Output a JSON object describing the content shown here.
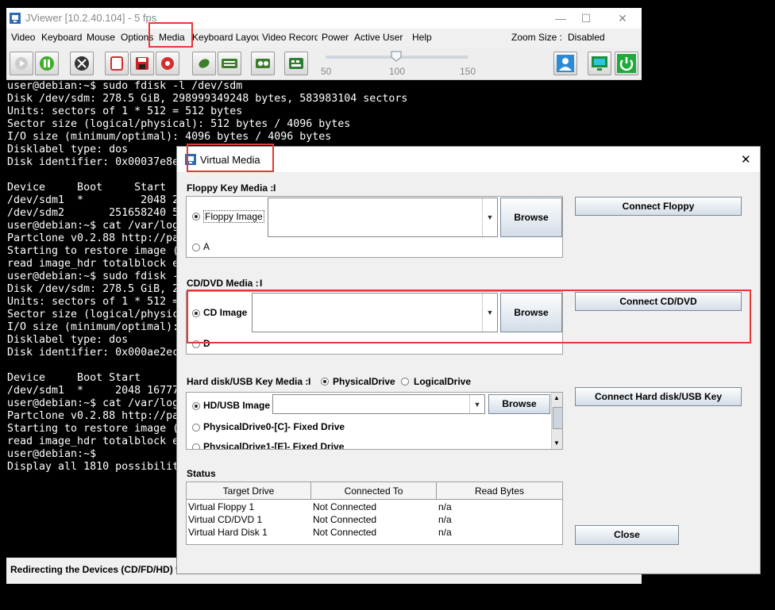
{
  "window": {
    "title": "JViewer [10.2.40.104] - 5 fps",
    "minimize": "—",
    "maximize": "☐",
    "close": "✕"
  },
  "menu": [
    {
      "label": "Video"
    },
    {
      "label": "Keyboard"
    },
    {
      "label": "Mouse"
    },
    {
      "label": "Options"
    },
    {
      "label": "Media"
    },
    {
      "label": "Keyboard Layout"
    },
    {
      "label": "Video Record"
    },
    {
      "label": "Power"
    },
    {
      "label": "Active User"
    },
    {
      "label": "Help"
    }
  ],
  "zoom": {
    "label": "Zoom Size :",
    "value": "Disabled"
  },
  "slider": {
    "min_label": "50",
    "mid_label": "100",
    "max_label": "150",
    "value": 100
  },
  "terminal": {
    "lines": "user@debian:~$ sudo fdisk -l /dev/sdm\nDisk /dev/sdm: 278.5 GiB, 298999349248 bytes, 583983104 sectors\nUnits: sectors of 1 * 512 = 512 bytes\nSector size (logical/physical): 512 bytes / 4096 bytes\nI/O size (minimum/optimal): 4096 bytes / 4096 bytes\nDisklabel type: dos\nDisk identifier: 0x00037e8e\n\nDevice     Boot     Start\n/dev/sdm1  *         2048 2\n/dev/sdm2       251658240 5\nuser@debian:~$ cat /var/log\nPartclone v0.2.88 http://pa\nStarting to restore image (\nread image_hdr totalblock e\nuser@debian:~$ sudo fdisk -\nDisk /dev/sdm: 278.5 GiB, 2\nUnits: sectors of 1 * 512 =\nSector size (logical/physic\nI/O size (minimum/optimal):\nDisklabel type: dos\nDisk identifier: 0x000ae2ec\n\nDevice     Boot Start\n/dev/sdm1  *     2048 16777\nuser@debian:~$ cat /var/log\nPartclone v0.2.88 http://pa\nStarting to restore image (\nread image_hdr totalblock e\nuser@debian:~$\nDisplay all 1810 possibilit"
  },
  "statusbar": {
    "text": "Redirecting the Devices (CD/FD/HD) to"
  },
  "dialog": {
    "title": "Virtual Media",
    "close": "✕",
    "floppy": {
      "heading": "Floppy Key Media :",
      "count": "I",
      "image_label": "Floppy Image",
      "drive_label": "A",
      "browse": "Browse",
      "connect": "Connect Floppy",
      "selected": "image"
    },
    "cd": {
      "heading": "CD/DVD Media :",
      "count": "I",
      "image_label": "CD Image",
      "drive_label": "D",
      "browse": "Browse",
      "connect": "Connect CD/DVD",
      "selected": "image"
    },
    "hd": {
      "heading": "Hard disk/USB Key Media :",
      "count": "I",
      "physical_label": "PhysicalDrive",
      "logical_label": "LogicalDrive",
      "image_label": "HD/USB Image",
      "drive0": "PhysicalDrive0-[C]- Fixed Drive",
      "drive1": "PhysicalDrive1-[E]- Fixed Drive",
      "browse": "Browse",
      "connect": "Connect Hard disk/USB Key"
    },
    "status": {
      "heading": "Status",
      "columns": [
        "Target Drive",
        "Connected To",
        "Read Bytes"
      ],
      "rows": [
        [
          "Virtual Floppy 1",
          "Not Connected",
          "n/a"
        ],
        [
          "Virtual CD/DVD 1",
          "Not Connected",
          "n/a"
        ],
        [
          "Virtual Hard Disk 1",
          "Not Connected",
          "n/a"
        ]
      ]
    },
    "close_button": "Close"
  },
  "colors": {
    "highlight": "#e53935",
    "terminal_bg": "#000000",
    "terminal_fg": "#ffffff"
  }
}
